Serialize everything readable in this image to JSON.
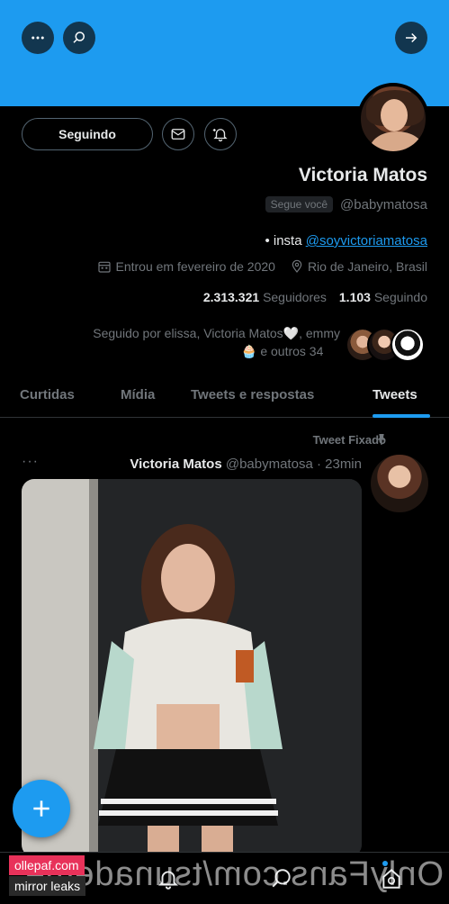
{
  "profile": {
    "name": "Victoria Matos",
    "handle": "@babymatosa",
    "follows_you": "Segue você",
    "bio_prefix": "• insta",
    "bio_link": "@soyvictoriamatosa",
    "location": "Rio de Janeiro, Brasil",
    "joined": "Entrou em fevereiro de 2020",
    "following_count": "1.103",
    "following_label": "Seguindo",
    "followers_count": "2.313.321",
    "followers_label": "Seguidores",
    "followed_by_line1": "Seguido por elissa, Victoria Matos🤍, emmy",
    "followed_by_line2": "🧁 e outros 34"
  },
  "actions": {
    "following_button": "Seguindo"
  },
  "tabs": [
    {
      "label": "Tweets",
      "active": true
    },
    {
      "label": "Tweets e respostas",
      "active": false
    },
    {
      "label": "Mídia",
      "active": false
    },
    {
      "label": "Curtidas",
      "active": false
    }
  ],
  "tweet": {
    "pinned_label": "Tweet Fixado",
    "author_name": "Victoria Matos",
    "author_handle": "@babymatosa",
    "time": "· 23min",
    "more": "···"
  },
  "overlays": {
    "watermark": "OnlyFans.com/tsunademe",
    "tag_site": "ollepaf.com",
    "tag_mirror": "mirror leaks"
  },
  "colors": {
    "banner": "#1d9bf0",
    "accent": "#1d9bf0",
    "background": "#000000"
  },
  "icons": [
    "more-icon",
    "search-icon",
    "arrow-right-icon",
    "mail-icon",
    "notification-bell-icon",
    "location-icon",
    "calendar-icon",
    "pin-icon",
    "compose-icon",
    "bell-nav-icon",
    "search-nav-icon",
    "profile-nav-icon"
  ]
}
